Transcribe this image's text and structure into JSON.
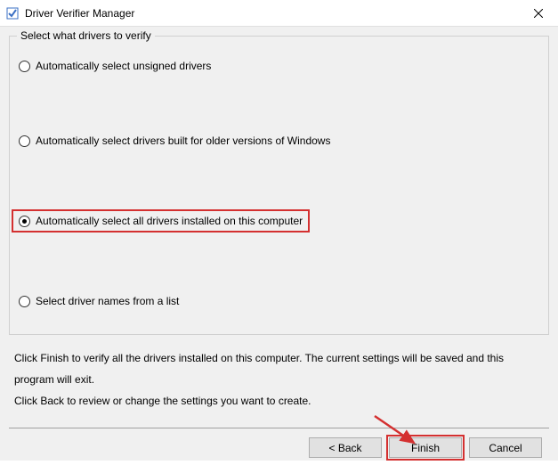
{
  "window": {
    "title": "Driver Verifier Manager"
  },
  "group": {
    "legend": "Select what drivers to verify",
    "options": {
      "unsigned": "Automatically select unsigned drivers",
      "older": "Automatically select drivers built for older versions of Windows",
      "all": "Automatically select all drivers installed on this computer",
      "list": "Select driver names from a list"
    }
  },
  "info": {
    "line1": "Click Finish to verify all the drivers installed on this computer. The current settings will be saved and this program will exit.",
    "line2": "Click Back to review or change the settings you want to create."
  },
  "buttons": {
    "back": "< Back",
    "finish": "Finish",
    "cancel": "Cancel"
  }
}
